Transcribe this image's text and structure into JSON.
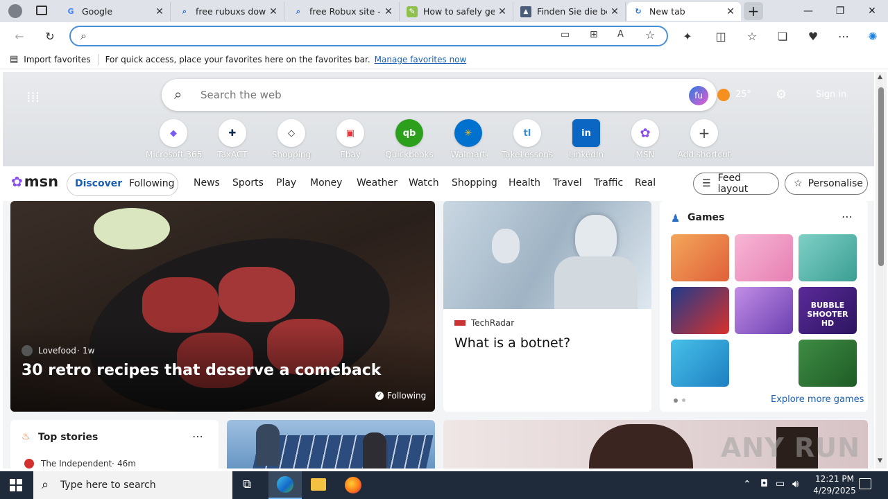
{
  "tabs": [
    {
      "title": "Google",
      "icon": "google-icon"
    },
    {
      "title": "free rubuxs downlo",
      "icon": "search-icon"
    },
    {
      "title": "free Robux site - Se",
      "icon": "search-icon"
    },
    {
      "title": "How to safely get f",
      "icon": "site-icon"
    },
    {
      "title": "Finden Sie die best",
      "icon": "site-icon"
    },
    {
      "title": "New tab",
      "icon": "edge-icon"
    }
  ],
  "address_bar": {
    "value": "",
    "placeholder": ""
  },
  "favorites_bar": {
    "import_label": "Import favorites",
    "message": "For quick access, place your favorites here on the favorites bar.",
    "manage_link": "Manage favorites now"
  },
  "search": {
    "placeholder": "Search the web",
    "copilot_label": "fu"
  },
  "header": {
    "weather": "25°",
    "signin": "Sign in"
  },
  "shortcuts": [
    {
      "label": "Microsoft 365",
      "glyph": "◆",
      "color": "#7b5cf0"
    },
    {
      "label": "TaxACT",
      "glyph": "✚",
      "color": "#0d2a4f"
    },
    {
      "label": "Shopping",
      "glyph": "◇",
      "color": "#333333"
    },
    {
      "label": "Ebay",
      "glyph": "▣",
      "color": "#e53238"
    },
    {
      "label": "Quickbooks",
      "glyph": "qb",
      "color": "#2ca01c"
    },
    {
      "label": "Walmart",
      "glyph": "✳",
      "color": "#ffc220"
    },
    {
      "label": "TakeLessons",
      "glyph": "tl",
      "color": "#3b8fd6"
    },
    {
      "label": "LinkedIn",
      "glyph": "in",
      "color": "#0a66c2"
    },
    {
      "label": "MSN",
      "glyph": "✿",
      "color": "#8a4ff0"
    },
    {
      "label": "Add shortcut",
      "glyph": "+",
      "color": "#444444"
    }
  ],
  "msn": {
    "logo": "msn",
    "toggle": [
      "Discover",
      "Following"
    ],
    "nav": [
      "News",
      "Sports",
      "Play",
      "Money",
      "Weather",
      "Watch",
      "Shopping",
      "Health",
      "Travel",
      "Traffic",
      "Real E"
    ],
    "feed_layout": "Feed layout",
    "personalise": "Personalise"
  },
  "hero": {
    "source": "Lovefood",
    "age": "1w",
    "title": "30 retro recipes that deserve a comeback",
    "following": "Following"
  },
  "story2": {
    "source": "TechRadar",
    "title": "What is a botnet?"
  },
  "games": {
    "title": "Games",
    "explore": "Explore more games",
    "tiles": [
      {
        "name": "game-tile-family",
        "c1": "#f3a65a",
        "c2": "#e0603a",
        "label": ""
      },
      {
        "name": "game-tile-princess",
        "c1": "#f7b6d4",
        "c2": "#e77fb3",
        "label": ""
      },
      {
        "name": "game-tile-hospital",
        "c1": "#7fd0c6",
        "c2": "#3b9e93",
        "label": ""
      },
      {
        "name": "game-tile-blocks",
        "c1": "#1f3b8c",
        "c2": "#d8322b",
        "label": ""
      },
      {
        "name": "game-tile-makeup",
        "c1": "#c28ee6",
        "c2": "#6b3fb0",
        "label": ""
      },
      {
        "name": "game-tile-bubble",
        "c1": "#5b2a99",
        "c2": "#2c1560",
        "label": "BUBBLE SHOOTER HD"
      },
      {
        "name": "game-tile-foot",
        "c1": "#47c0e8",
        "c2": "#1d7fc2",
        "label": ""
      },
      {
        "name": "game-tile-empty",
        "c1": "#ffffff",
        "c2": "#ffffff",
        "label": ""
      },
      {
        "name": "game-tile-mahjong",
        "c1": "#3e8c44",
        "c2": "#1f5c26",
        "label": ""
      }
    ]
  },
  "top_stories": {
    "title": "Top stories",
    "first_source": "The Independent",
    "first_age": "46m"
  },
  "watermark": "ANY RUN",
  "taskbar": {
    "search_placeholder": "Type here to search",
    "time": "12:21 PM",
    "date": "4/29/2025"
  }
}
